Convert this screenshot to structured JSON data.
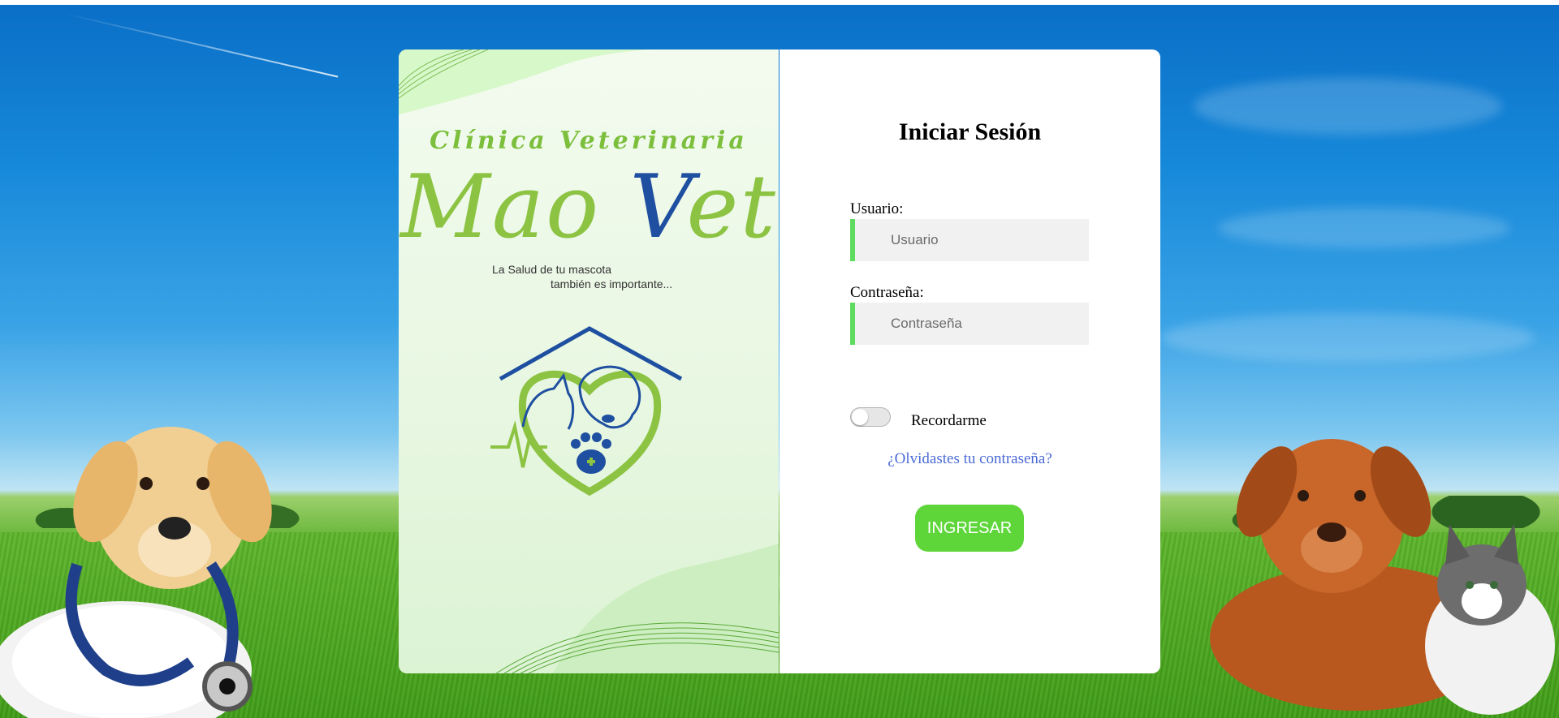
{
  "colors": {
    "accent_green": "#5ed63a",
    "field_bar": "#5fdc5f",
    "link_blue": "#4a6ad6",
    "brand_green": "#8cc342",
    "brand_blue": "#1e4fa0"
  },
  "brand": {
    "subtitle": "Clínica Veterinaria",
    "name_part1": "Mao ",
    "name_v": "V",
    "name_part2": "et",
    "tagline_line1": "La Salud de tu mascota",
    "tagline_line2": "también es importante..."
  },
  "login": {
    "title": "Iniciar Sesión",
    "user_label": "Usuario:",
    "user_placeholder": "Usuario",
    "user_value": "",
    "password_label": "Contraseña:",
    "password_placeholder": "Contraseña",
    "password_value": "",
    "remember_label": "Recordarme",
    "remember_checked": false,
    "forgot_link": "¿Olvidastes tu contraseña?",
    "submit_label": "INGRESAR"
  },
  "icons": [
    "house-heart-pet-logo-icon",
    "paw-icon",
    "medical-cross-icon",
    "heartbeat-line-icon"
  ]
}
